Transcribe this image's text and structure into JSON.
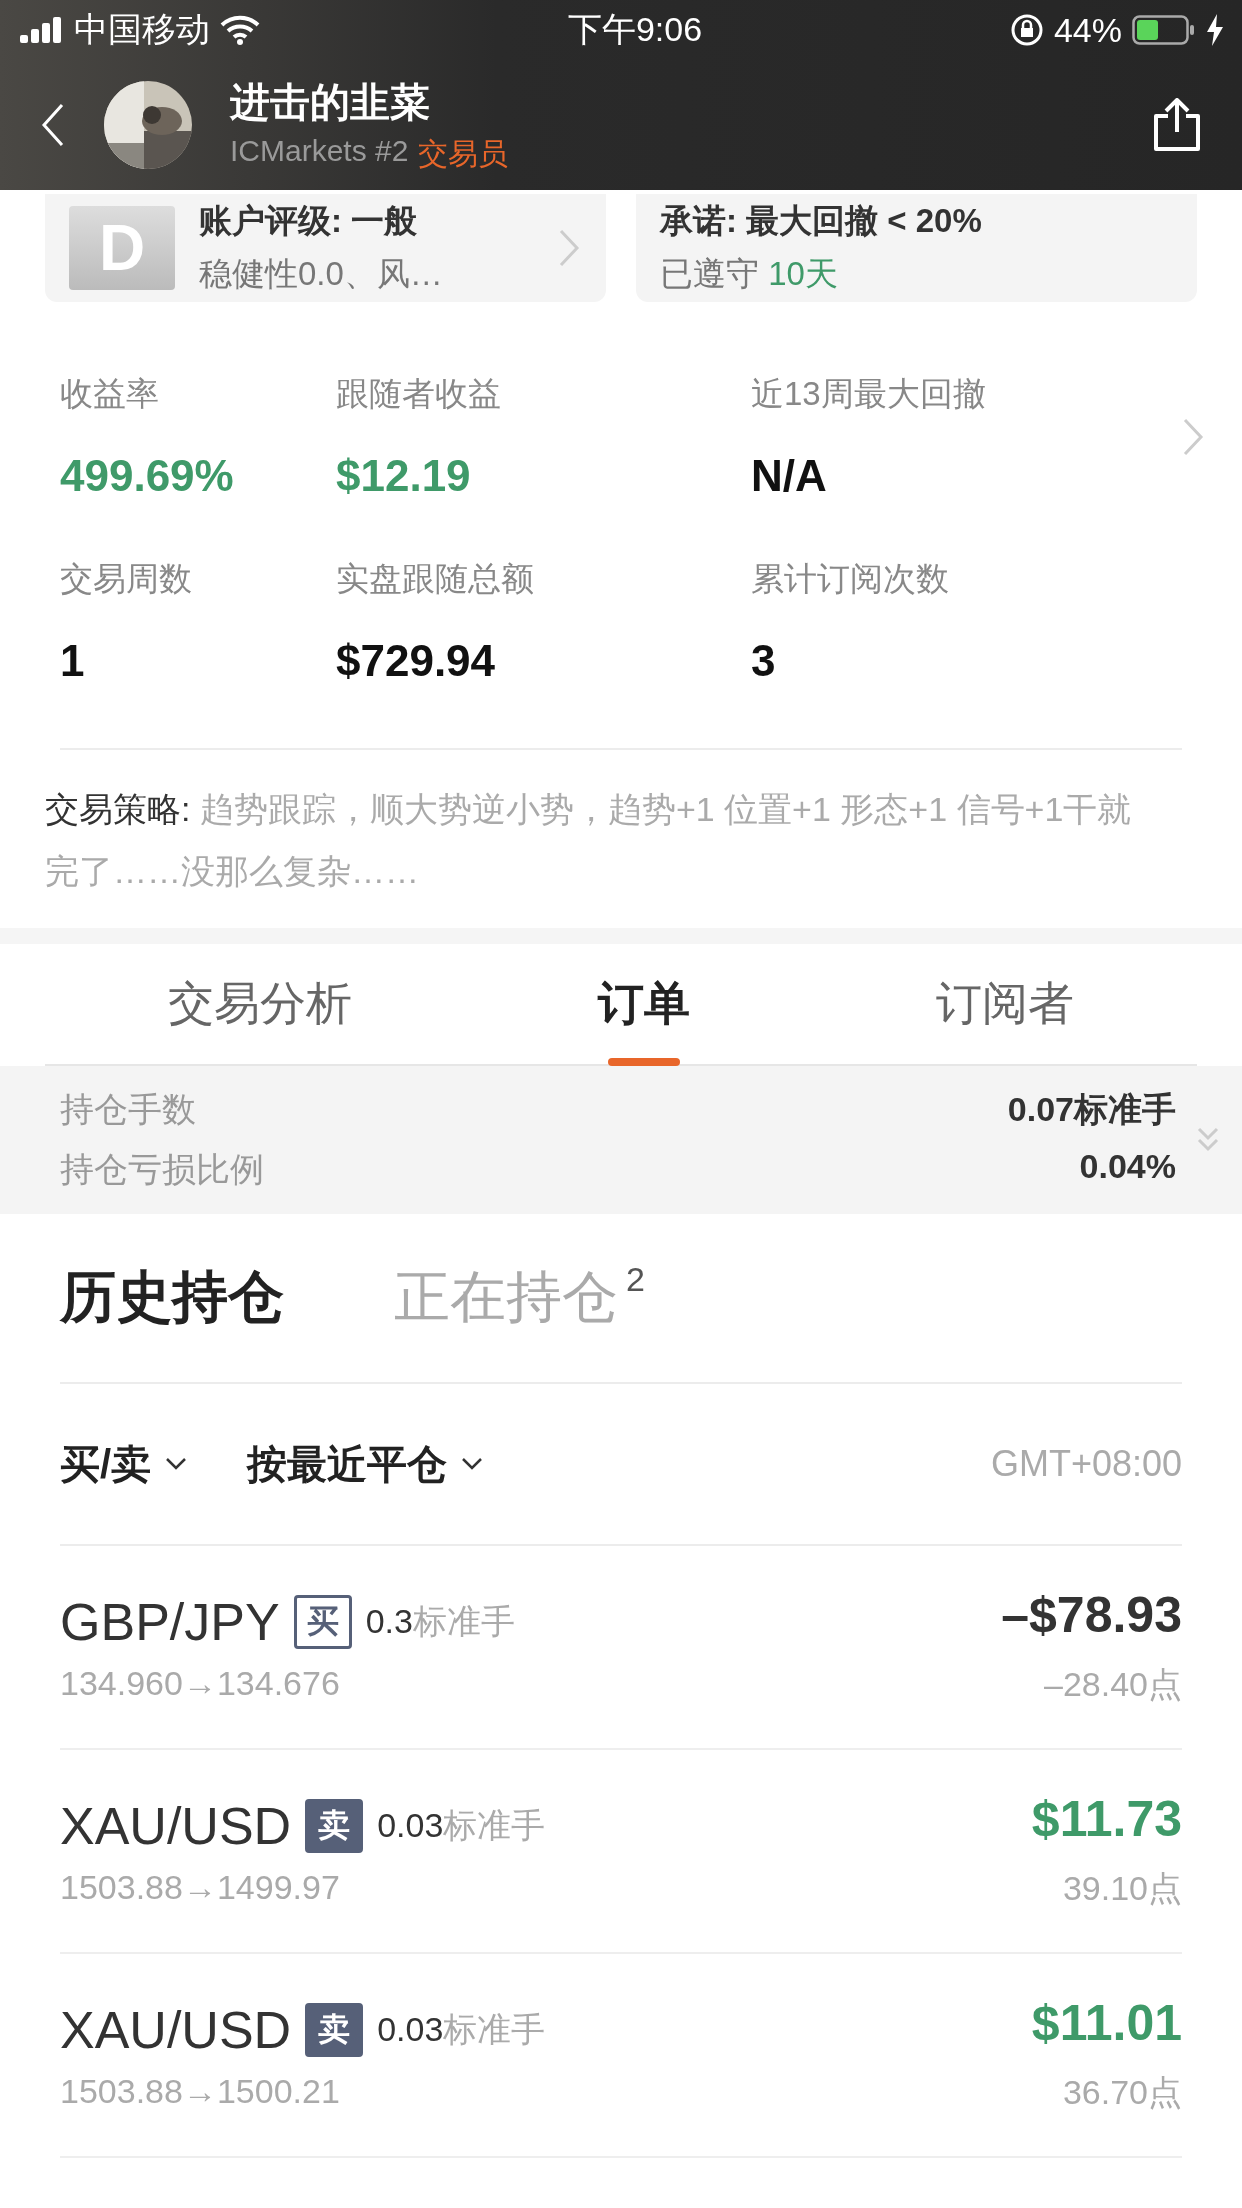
{
  "status_bar": {
    "carrier": "中国移动",
    "time": "下午9:06",
    "battery": "44%"
  },
  "header": {
    "name": "进击的韭菜",
    "broker": "ICMarkets #2",
    "role": "交易员"
  },
  "cards": [
    {
      "kind": "rating",
      "grade": "D",
      "title": "账户评级: 一般",
      "subtitle": "稳健性0.0、风…"
    },
    {
      "kind": "promise",
      "title": "承诺: 最大回撤 < 20%",
      "subtitle": "已遵守",
      "highlight": "10天"
    }
  ],
  "stats": [
    {
      "label": "收益率",
      "value": "499.69%",
      "positive": true
    },
    {
      "label": "跟随者收益",
      "value": "$12.19",
      "positive": true
    },
    {
      "label": "近13周最大回撤",
      "value": "N/A",
      "positive": false
    },
    {
      "label": "交易周数",
      "value": "1",
      "positive": false
    },
    {
      "label": "实盘跟随总额",
      "value": "$729.94",
      "positive": false
    },
    {
      "label": "累计订阅次数",
      "value": "3",
      "positive": false
    }
  ],
  "strategy": {
    "label": "交易策略:",
    "text": "趋势跟踪，顺大势逆小势，趋势+1 位置+1 形态+1 信号+1干就完了……没那么复杂……"
  },
  "tabs": [
    {
      "label": "交易分析",
      "selected": false
    },
    {
      "label": "订单",
      "selected": true
    },
    {
      "label": "订阅者",
      "selected": false
    }
  ],
  "summary": [
    {
      "label": "持仓手数",
      "value": "0.07标准手"
    },
    {
      "label": "持仓亏损比例",
      "value": "0.04%"
    }
  ],
  "subtabs": [
    {
      "label": "历史持仓",
      "selected": true
    },
    {
      "label": "正在持仓",
      "selected": false,
      "count": "2"
    }
  ],
  "filters": [
    {
      "label": "买/卖"
    },
    {
      "label": "按最近平仓"
    }
  ],
  "timezone": "GMT+08:00",
  "orders": [
    {
      "symbol": "GBP/JPY",
      "kind": "buy",
      "side": "买",
      "lots": "0.3",
      "unit": "标准手",
      "prices": "134.960→134.676",
      "profit": "–$78.93",
      "points": "–28.40点",
      "positive": false
    },
    {
      "symbol": "XAU/USD",
      "kind": "sell",
      "side": "卖",
      "lots": "0.03",
      "unit": "标准手",
      "prices": "1503.88→1499.97",
      "profit": "$11.73",
      "points": "39.10点",
      "positive": true
    },
    {
      "symbol": "XAU/USD",
      "kind": "sell",
      "side": "卖",
      "lots": "0.03",
      "unit": "标准手",
      "prices": "1503.88→1500.21",
      "profit": "$11.01",
      "points": "36.70点",
      "positive": true
    }
  ]
}
